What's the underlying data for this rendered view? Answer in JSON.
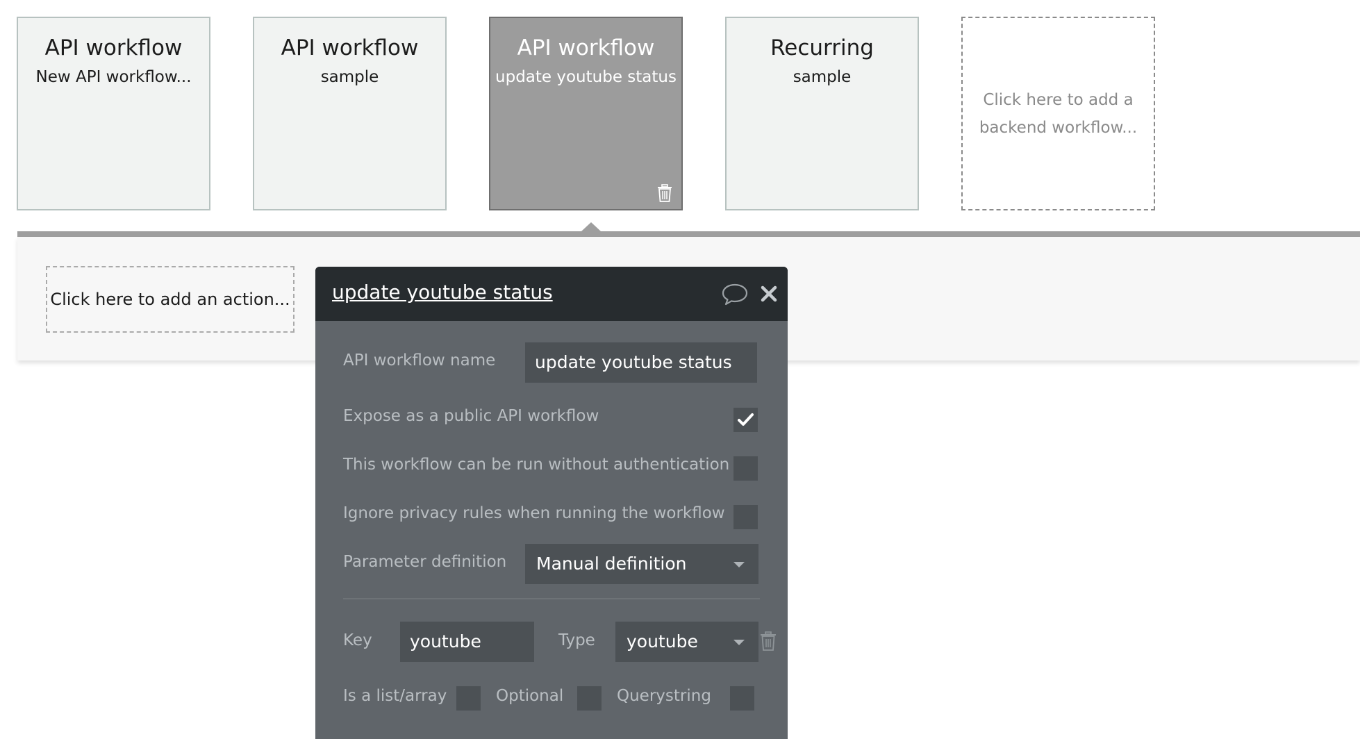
{
  "workflow_cards": [
    {
      "title": "API workflow",
      "subtitle": "New API workflow..."
    },
    {
      "title": "API workflow",
      "subtitle": "sample"
    },
    {
      "title": "API workflow",
      "subtitle": "update youtube status"
    },
    {
      "title": "Recurring",
      "subtitle": "sample"
    }
  ],
  "add_workflow_card": {
    "label": "Click here to add a backend workflow..."
  },
  "action_area": {
    "add_action_label": "Click here to add an action..."
  },
  "panel": {
    "title": "update youtube status",
    "name_label": "API workflow name",
    "name_value": "update youtube status",
    "expose_label": "Expose as a public API workflow",
    "expose_checked": true,
    "no_auth_label": "This workflow can be run without authentication",
    "no_auth_checked": false,
    "ignore_privacy_label": "Ignore privacy rules when running the workflow",
    "ignore_privacy_checked": false,
    "param_def_label": "Parameter definition",
    "param_def_value": "Manual definition",
    "parameter": {
      "key_label": "Key",
      "key_value": "youtube",
      "type_label": "Type",
      "type_value": "youtube",
      "is_list_label": "Is a list/array",
      "optional_label": "Optional",
      "querystring_label": "Querystring"
    }
  },
  "colors": {
    "panel_header": "#272c2f",
    "panel_body": "#60656a",
    "selected_card": "#9c9c9c"
  }
}
